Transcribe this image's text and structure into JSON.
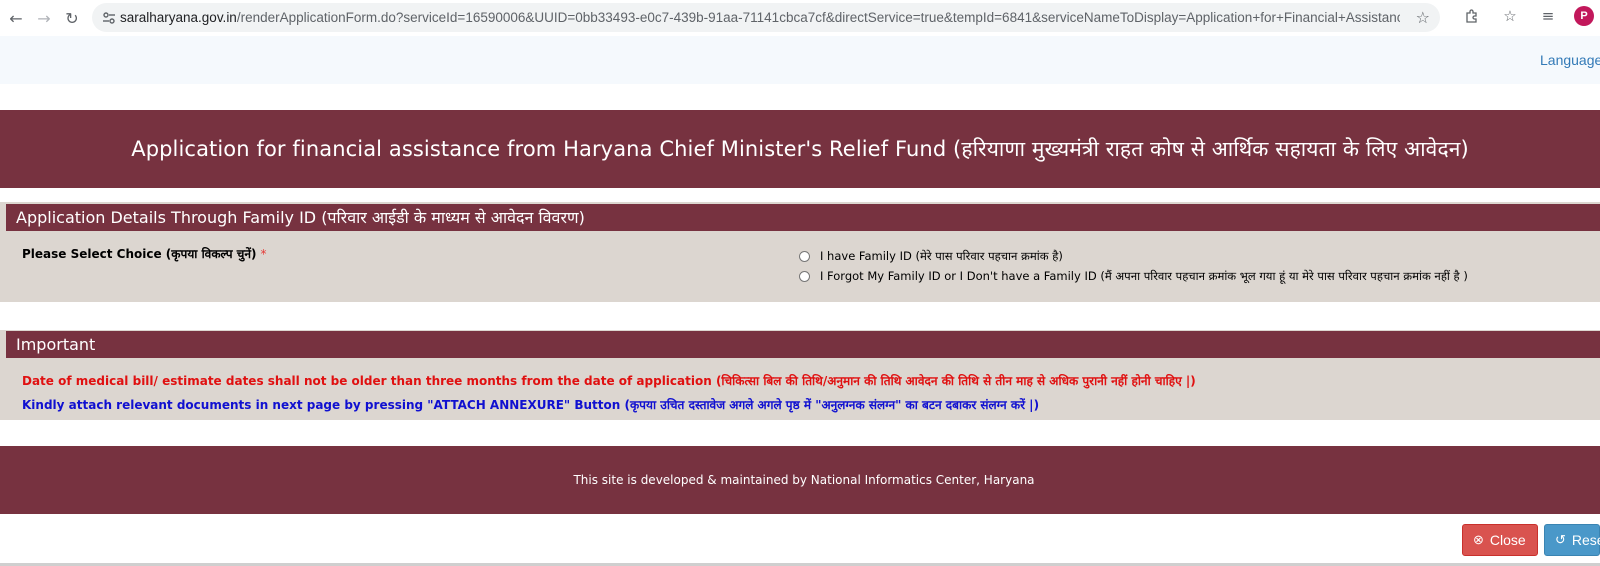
{
  "browser": {
    "url_host": "saralharyana.gov.in",
    "url_path": "/renderApplicationForm.do?serviceId=16590006&UUID=0bb33493-e0c7-439b-91aa-71141cbca7cf&directService=true&tempId=6841&serviceNameToDisplay=Application+for+Financial+Assistance+from+Haryana+Chie...",
    "avatar_letter": "P"
  },
  "header": {
    "language_label": "Language"
  },
  "banner": {
    "title": "Application for financial assistance from Haryana Chief Minister's Relief Fund (हरियाणा मुख्यमंत्री राहत कोष से आर्थिक सहायता के लिए आवेदन)"
  },
  "family_section": {
    "heading": "Application Details Through Family ID (परिवार आईडी के माध्यम से आवेदन विवरण)",
    "choice_label": "Please Select Choice (कृपया विकल्प चुनें)",
    "required_mark": "*",
    "options": [
      "I have Family ID (मेरे पास परिवार पहचान क्रमांक है)",
      "I Forgot My Family ID or I Don't have a Family ID (मैं अपना परिवार पहचान क्रमांक भूल गया हूं या मेरे पास परिवार पहचान क्रमांक नहीं है )"
    ]
  },
  "important_section": {
    "heading": "Important",
    "note_red": "Date of medical bill/ estimate dates shall not be older than three months from the date of application (चिकित्सा बिल की तिथि/अनुमान की तिथि आवेदन की तिथि से तीन माह से अधिक पुरानी नहीं होनी चाहिए |)",
    "note_blue": "Kindly attach relevant documents in next page by pressing \"ATTACH ANNEXURE\" Button (कृपया उचित दस्तावेज अगले अगले पृष्ठ में \"अनुलग्नक संलग्न\" का बटन दबाकर संलग्न करें |)"
  },
  "footer": {
    "text": "This site is developed & maintained by National Informatics Center, Haryana"
  },
  "actions": {
    "close_label": "Close",
    "reset_label": "Rese"
  },
  "colors": {
    "brand": "#773240",
    "section_bg": "#dcd6d0",
    "close_button": "#d9534f",
    "reset_button": "#4a98c9",
    "link": "#337ab7"
  }
}
